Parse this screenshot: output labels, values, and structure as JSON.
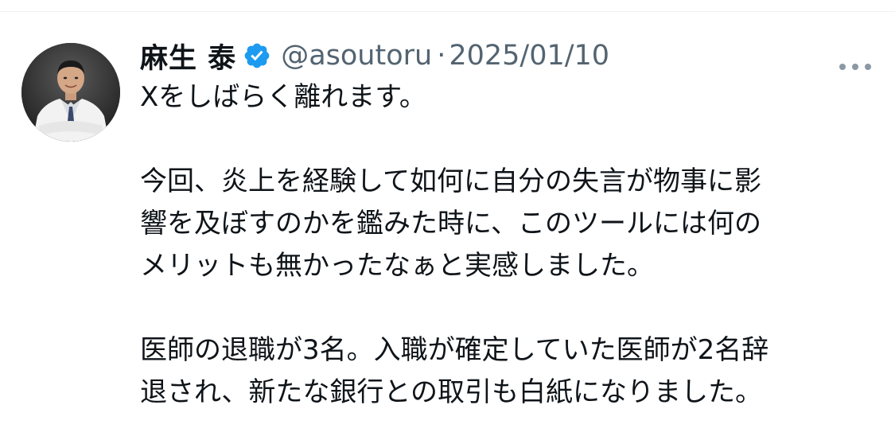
{
  "tweet": {
    "author": {
      "display_name": "麻生 泰",
      "handle": "@asoutoru",
      "verified": true,
      "verified_color": "#1d9bf0"
    },
    "separator": "·",
    "date": "2025/01/10",
    "more_icon": "more-horizontal-icon",
    "text_lines": [
      "Xをしばらく離れます。",
      "今回、炎上を経験して如何に自分の失言が物事に影",
      "響を及ぼすのかを鑑みた時に、このツールには何の",
      "メリットも無かったなぁと実感しました。",
      "医師の退職が3名。入職が確定していた医師が2名辞",
      "退され、新たな銀行との取引も白紙になりました。"
    ]
  }
}
